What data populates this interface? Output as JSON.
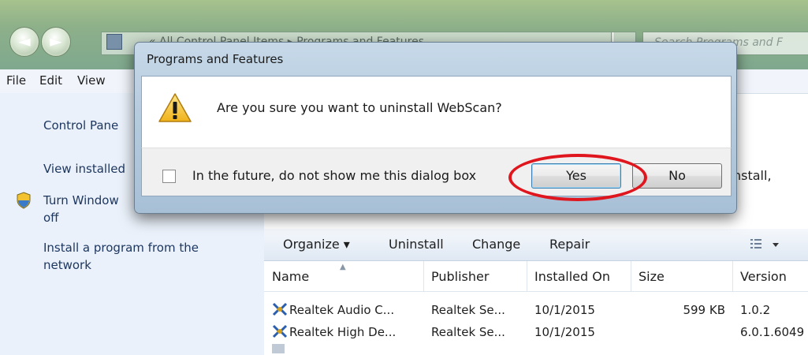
{
  "window": {
    "address_text": "« All Control Panel Items ▸ Programs and Features",
    "search_placeholder": "Search Programs and F"
  },
  "menu": [
    "File",
    "Edit",
    "View"
  ],
  "left_pane": {
    "items": [
      "Control Panel Home",
      "View installed updates",
      "Turn Windows features on or off",
      "Install a program from the network"
    ],
    "item_lines": {
      "control_panel": "Control Pane",
      "view_installed": "View installed",
      "turn_windows_1": "Turn Window",
      "turn_windows_2": "off",
      "install_1": "Install a program from the",
      "install_2": "network"
    }
  },
  "behind_text": "nstall,",
  "command_bar": {
    "organize": "Organize ▾",
    "uninstall": "Uninstall",
    "change": "Change",
    "repair": "Repair",
    "view_icon": "view-options-icon"
  },
  "table": {
    "headers": [
      "Name",
      "Publisher",
      "Installed On",
      "Size",
      "Version"
    ],
    "rows": [
      {
        "name": "Realtek Audio C...",
        "publisher": "Realtek Se...",
        "installed_on": "10/1/2015",
        "size": "599 KB",
        "version": "1.0.2"
      },
      {
        "name": "Realtek High De...",
        "publisher": "Realtek Se...",
        "installed_on": "10/1/2015",
        "size": "",
        "version": "6.0.1.6049"
      }
    ]
  },
  "dialog": {
    "title": "Programs and Features",
    "message": "Are you sure you want to uninstall WebScan?",
    "checkbox_label": "In the future, do not show me this dialog box",
    "checkbox_checked": false,
    "yes_label": "Yes",
    "no_label": "No",
    "icon": "warning-icon"
  },
  "colors": {
    "annotation_red": "#e0161e",
    "dialog_frame": "#b4cadd",
    "window_chrome": "#8db08a"
  }
}
